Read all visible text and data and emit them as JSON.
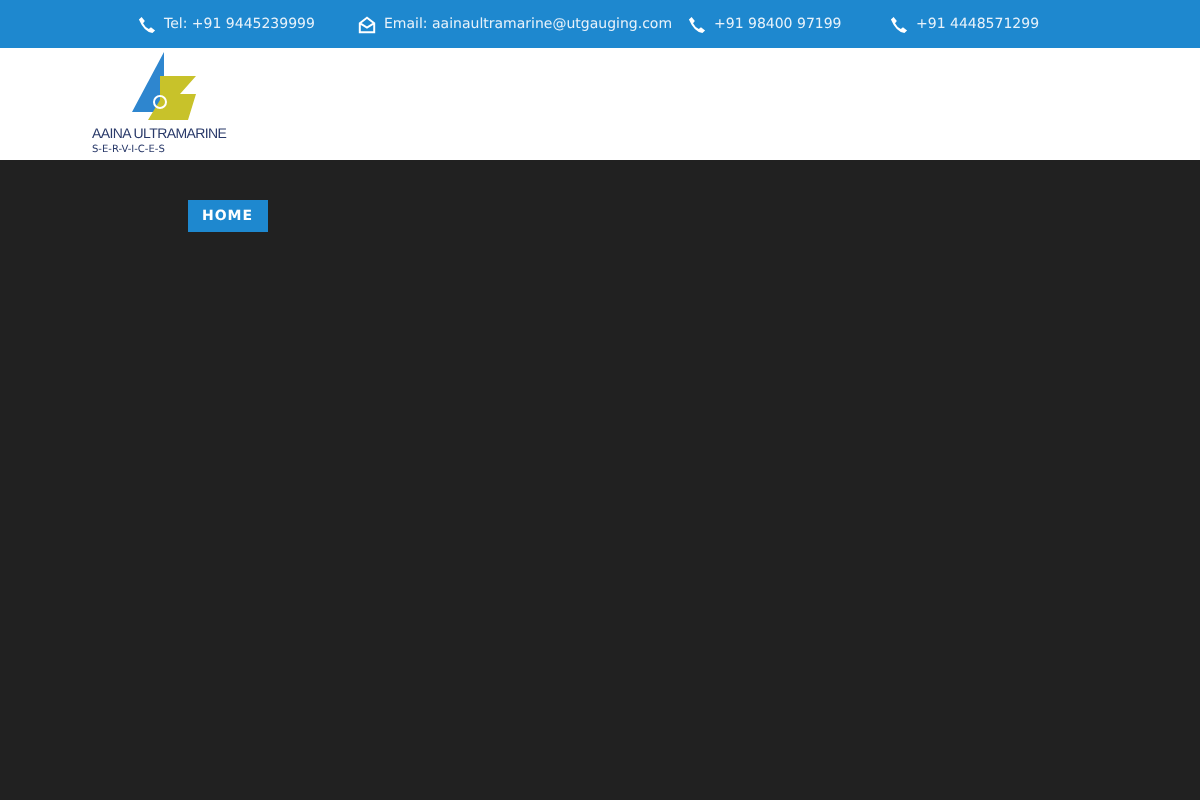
{
  "contact_bar": [
    {
      "kind": "phone",
      "text": "Tel: +91 9445239999"
    },
    {
      "kind": "email",
      "text": "Email: aainaultramarine@utgauging.com"
    },
    {
      "kind": "phone",
      "text": "+91 98400 97199"
    },
    {
      "kind": "phone",
      "text": "+91 4448571299"
    }
  ],
  "logo": {
    "name": "AAINA ULTRAMARINE",
    "tagline": "S-E-R-V-I-C-E-S"
  },
  "nav": [
    {
      "label": "HOME",
      "selected": true
    }
  ]
}
